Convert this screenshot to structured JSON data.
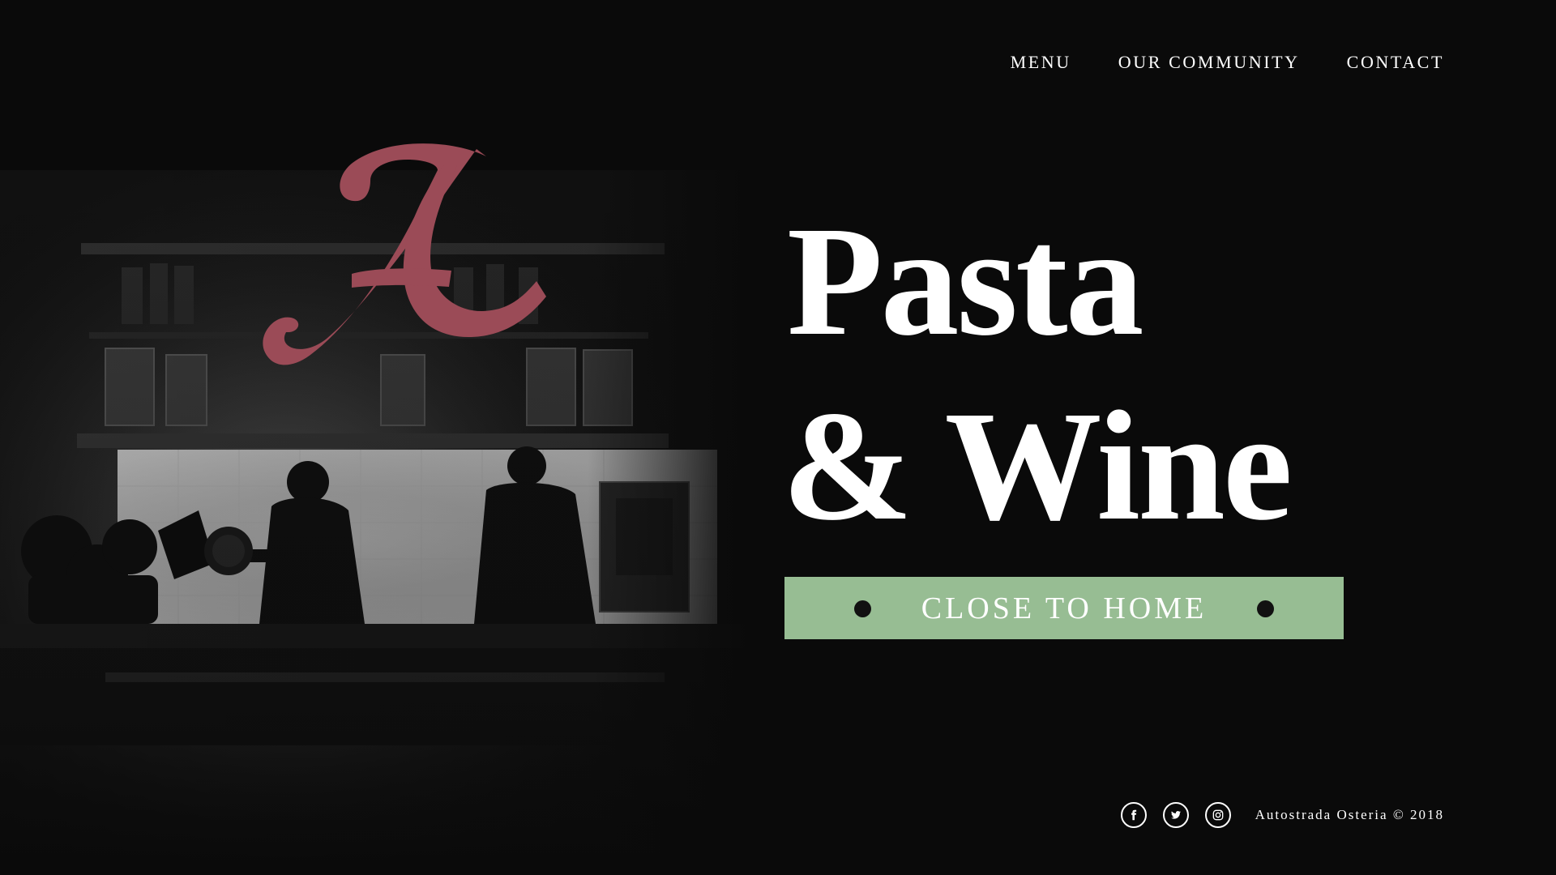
{
  "nav": {
    "items": [
      {
        "label": "MENU"
      },
      {
        "label": "OUR COMMUNITY"
      },
      {
        "label": "CONTACT"
      }
    ]
  },
  "hero": {
    "headline_line_1": "Pasta",
    "headline_line_2": "& Wine",
    "tagline": "CLOSE TO HOME"
  },
  "brand": {
    "monogram": "A",
    "accent_color": "#9b4b57",
    "tagline_bg": "#97bd93"
  },
  "footer": {
    "copyright": "Autostrada Osteria © 2018",
    "social_icons": [
      {
        "name": "facebook-icon"
      },
      {
        "name": "twitter-icon"
      },
      {
        "name": "instagram-icon"
      }
    ]
  }
}
